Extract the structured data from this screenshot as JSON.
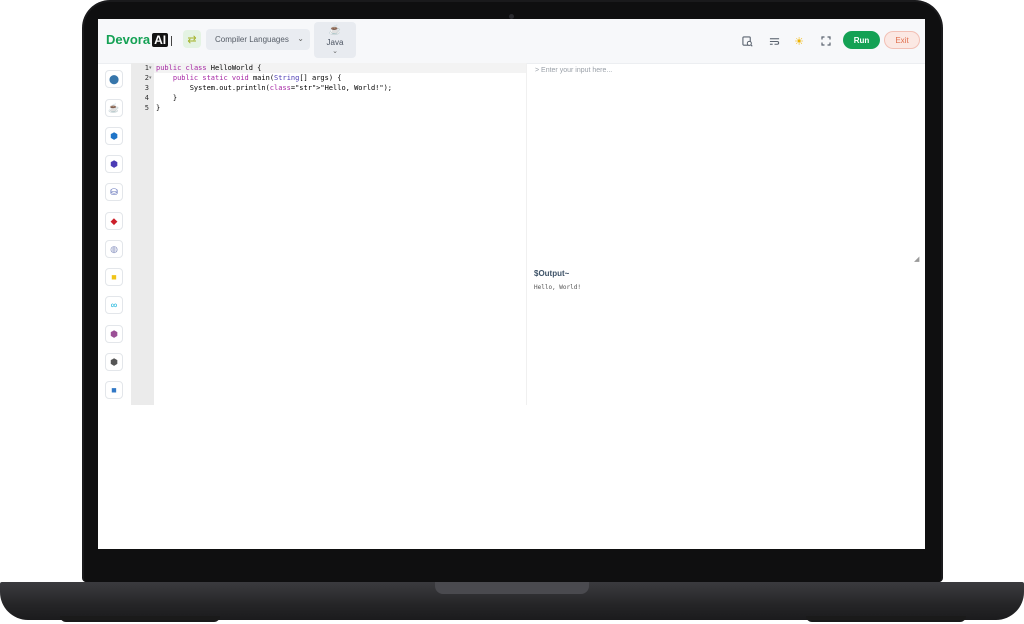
{
  "header": {
    "brand_name": "Devora",
    "brand_suffix": "AI",
    "swap_icon": "swap-arrows-icon",
    "language_select_value": "Compiler Languages",
    "active_language": "Java",
    "run_label": "Run",
    "exit_label": "Exit",
    "toolbar_icons": [
      "search-doc-icon",
      "wrap-text-icon",
      "sun-icon",
      "fullscreen-icon"
    ],
    "accent_color": "#14a154",
    "exit_color": "#e0704f"
  },
  "sidebar": {
    "items": [
      {
        "name": "python",
        "glyph": "🐍",
        "color": "#3776ab"
      },
      {
        "name": "java",
        "glyph": "☕",
        "color": "#e76f00"
      },
      {
        "name": "c",
        "glyph": "⬢",
        "color": "#1f74c8"
      },
      {
        "name": "cpp",
        "glyph": "⬢",
        "color": "#4b3bb5"
      },
      {
        "name": "sql",
        "glyph": "⛁",
        "color": "#3b4fa8"
      },
      {
        "name": "ruby",
        "glyph": "◆",
        "color": "#cc1f2a"
      },
      {
        "name": "php",
        "glyph": "◍",
        "color": "#8892bf"
      },
      {
        "name": "javascript",
        "glyph": "■",
        "color": "#f0c419"
      },
      {
        "name": "go",
        "glyph": "∞",
        "color": "#00acd7"
      },
      {
        "name": "csharp",
        "glyph": "⬢",
        "color": "#9b4f96"
      },
      {
        "name": "nodejs",
        "glyph": "⬢",
        "color": "#555555"
      },
      {
        "name": "typescript",
        "glyph": "■",
        "color": "#3178c6"
      }
    ]
  },
  "editor": {
    "line_numbers": [
      "1",
      "2",
      "3",
      "4",
      "5"
    ],
    "lines": [
      "public class HelloWorld {",
      "    public static void main(String[] args) {",
      "        System.out.println(\"Hello, World!\");",
      "    }",
      "}"
    ]
  },
  "input": {
    "placeholder": "> Enter your input here..."
  },
  "output": {
    "title": "$Output~",
    "text": "Hello, World!"
  }
}
